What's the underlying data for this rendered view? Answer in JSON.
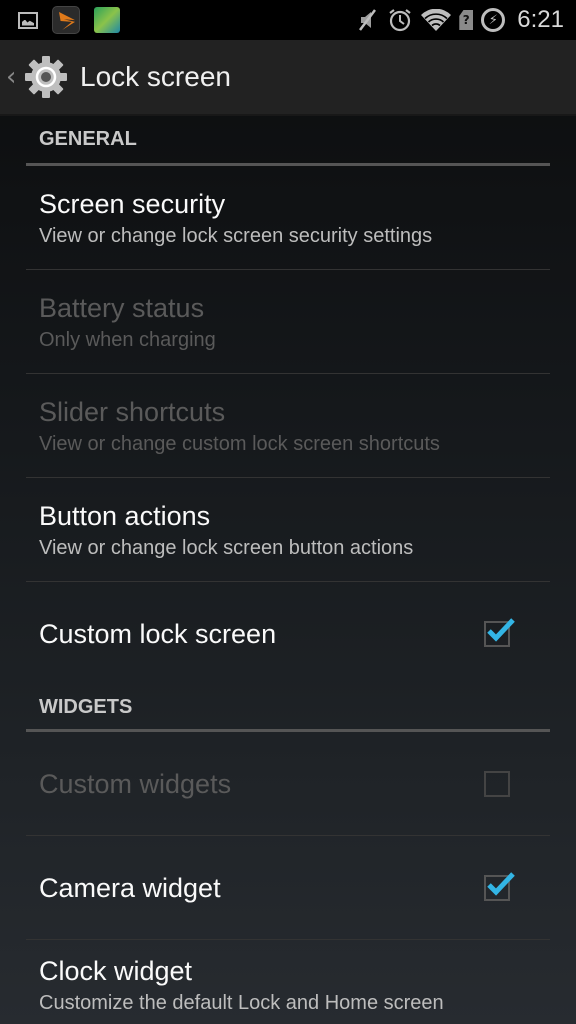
{
  "status_bar": {
    "notifications": [
      "gallery-icon",
      "app-notification-icon",
      "game-notification-icon"
    ],
    "indicators": [
      "mute-icon",
      "alarm-icon",
      "wifi-icon",
      "no-sim-icon",
      "battery-charging-icon"
    ],
    "sim_glyph": "?",
    "time": "6:21"
  },
  "action_bar": {
    "title": "Lock screen",
    "icon": "settings-gear-icon"
  },
  "sections": [
    {
      "header": "GENERAL",
      "items": [
        {
          "title": "Screen security",
          "summary": "View or change lock screen security settings",
          "enabled": true
        },
        {
          "title": "Battery status",
          "summary": "Only when charging",
          "enabled": false
        },
        {
          "title": "Slider shortcuts",
          "summary": "View or change custom lock screen shortcuts",
          "enabled": false
        },
        {
          "title": "Button actions",
          "summary": "View or change lock screen button actions",
          "enabled": true
        },
        {
          "title": "Custom lock screen",
          "checked": true,
          "enabled": true
        }
      ]
    },
    {
      "header": "WIDGETS",
      "items": [
        {
          "title": "Custom widgets",
          "checked": false,
          "enabled": false
        },
        {
          "title": "Camera widget",
          "checked": true,
          "enabled": true
        },
        {
          "title": "Clock widget",
          "summary": "Customize the default Lock and Home screen",
          "enabled": true
        }
      ]
    }
  ],
  "colors": {
    "accent": "#33b5e5",
    "background_top": "#0b0c0d",
    "background_bottom": "#272b30",
    "action_bar": "#222222",
    "disabled_text": "#5a5a5a"
  }
}
